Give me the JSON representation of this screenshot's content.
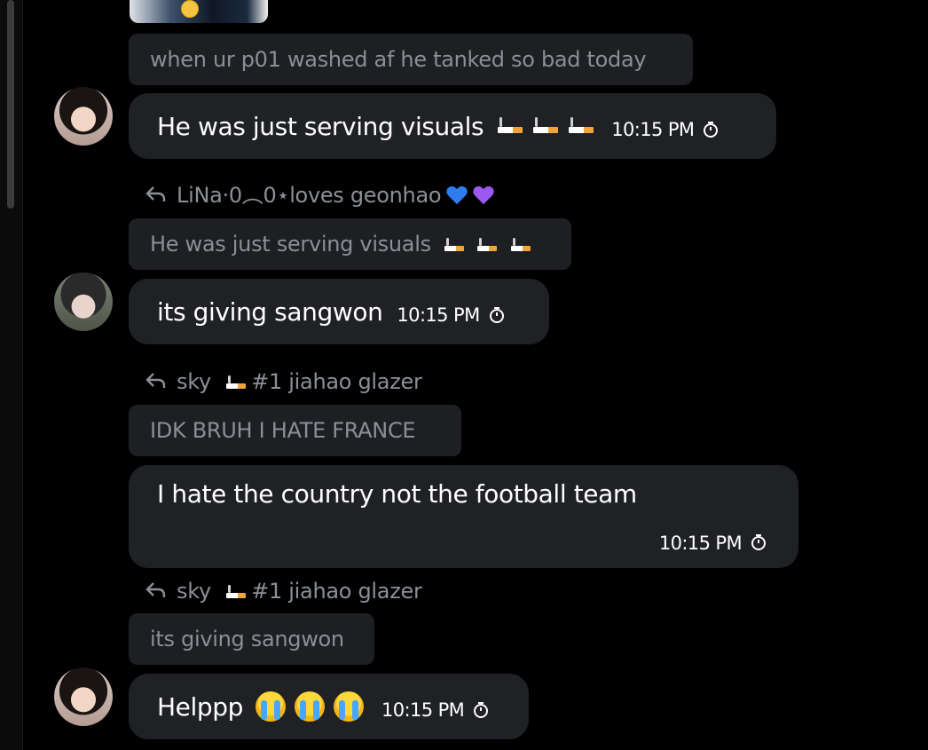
{
  "quote_0": {
    "text": "when ur p01 washed af he tanked so bad today"
  },
  "msg_0": {
    "text": "He was just serving visuals",
    "time": "10:15 PM"
  },
  "reply_1": {
    "author": "LiNa·0︵0⋆loves geonhao"
  },
  "quote_1": {
    "text": "He was just serving visuals"
  },
  "msg_1": {
    "text": "its giving sangwon",
    "time": "10:15 PM"
  },
  "reply_2": {
    "author": "sky",
    "suffix": "#1 jiahao glazer"
  },
  "quote_2": {
    "text": "IDK BRUH I HATE FRANCE"
  },
  "msg_2": {
    "text": "I hate the country not the football team",
    "time": "10:15 PM"
  },
  "reply_3": {
    "author": "sky",
    "suffix": "#1 jiahao glazer"
  },
  "quote_3": {
    "text": "its giving sangwon"
  },
  "msg_3": {
    "text": "Helppp",
    "time": "10:15 PM"
  },
  "icons": {
    "reply": "reply-arrow-icon",
    "timer": "disappearing-timer-icon",
    "cigarette": "cigarette-emoji",
    "crying": "loudly-crying-face-emoji",
    "blue_heart": "blue-heart-emoji",
    "purple_heart": "purple-heart-emoji"
  },
  "colors": {
    "background": "#000000",
    "bubble": "#1f2125",
    "quoted_bubble": "#1d1f23",
    "muted_text": "#8b8f96",
    "text": "#ffffff"
  }
}
